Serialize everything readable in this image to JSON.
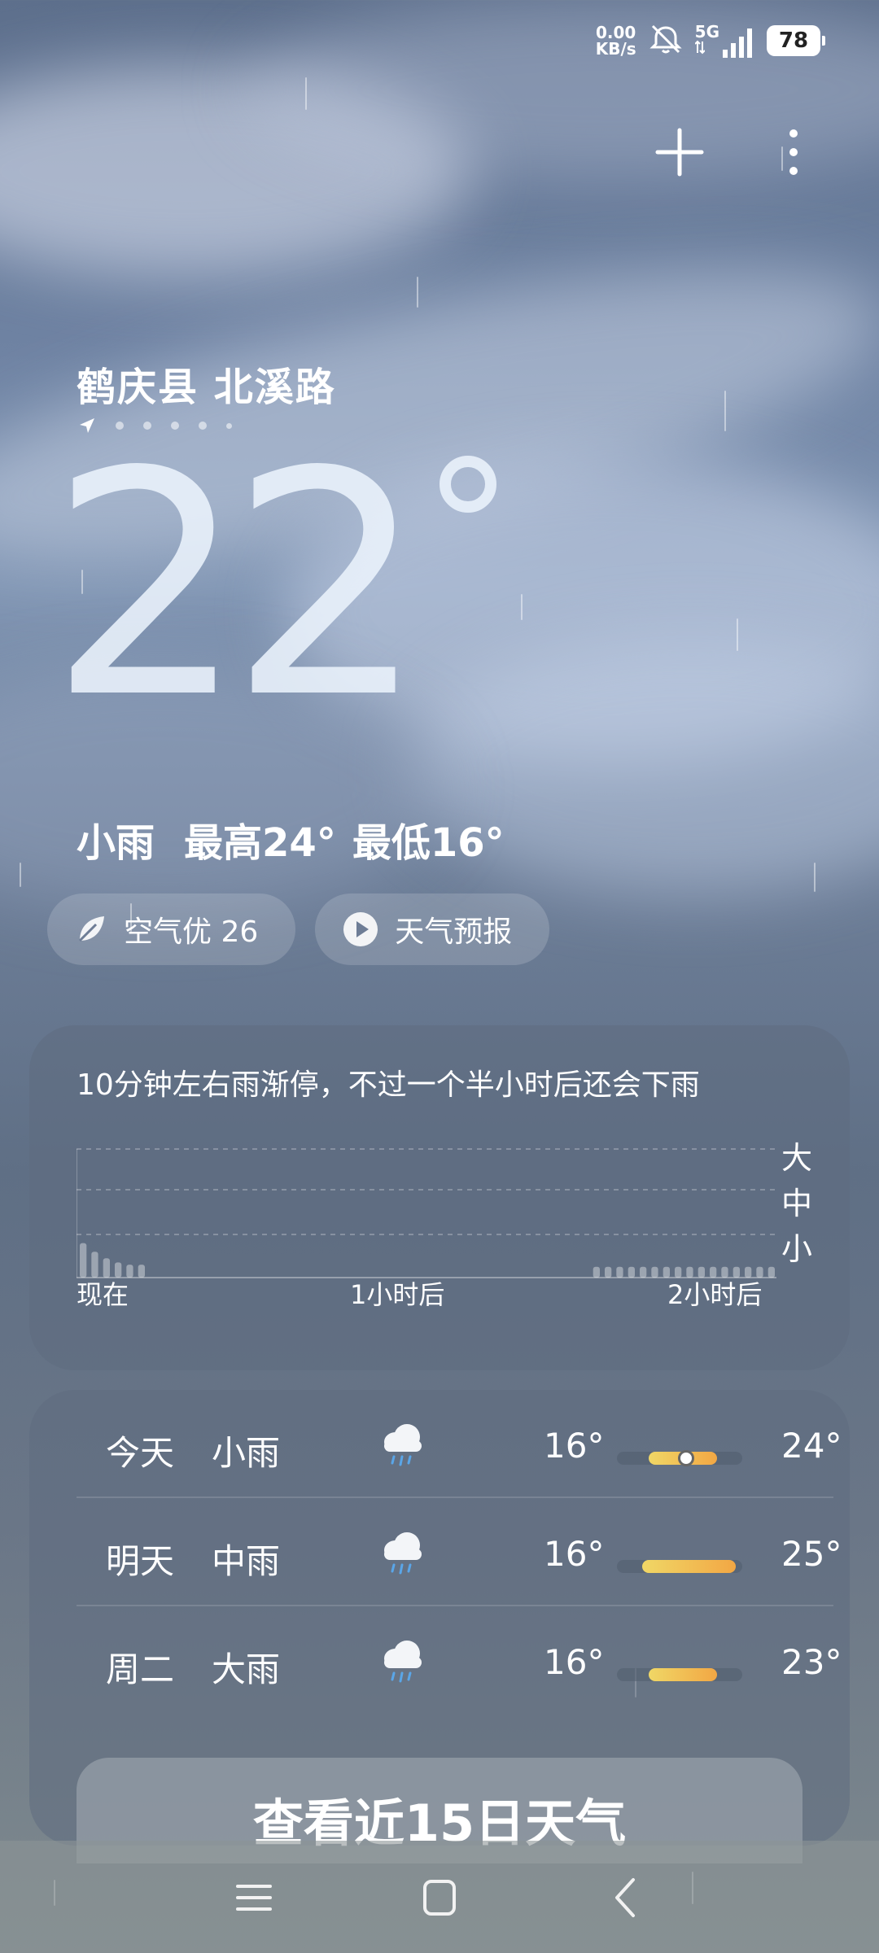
{
  "status_bar": {
    "net_speed_value": "0.00",
    "net_speed_unit": "KB/s",
    "network_type": "5G",
    "battery_level": "78",
    "icons": [
      "mute-vibrate-icon",
      "signal-icon",
      "battery-icon"
    ]
  },
  "header": {
    "location": "鹤庆县 北溪路",
    "page_count": 6,
    "current_page": 0
  },
  "current": {
    "temperature": "22",
    "condition": "小雨",
    "high": "最高24°",
    "low": "最低16°"
  },
  "pills": {
    "air_quality": "空气优 26",
    "forecast_video": "天气预报"
  },
  "rain_card": {
    "message": "10分钟左右雨渐停，不过一个半小时后还会下雨",
    "levels": [
      "大",
      "中",
      "小"
    ],
    "x_labels": [
      "现在",
      "1小时后",
      "2小时后"
    ]
  },
  "chart_data": {
    "type": "bar",
    "title": "",
    "xlabel": "",
    "ylabel": "",
    "categories": [
      "现在",
      "1小时后",
      "2小时后"
    ],
    "x_range_minutes": [
      0,
      120
    ],
    "ylim": [
      0,
      3
    ],
    "y_levels": [
      "小",
      "中",
      "大"
    ],
    "series": [
      {
        "values": [
          0.8,
          0.6,
          0.45,
          0.35,
          0.3,
          0.3,
          0,
          0,
          0,
          0,
          0,
          0,
          0,
          0,
          0,
          0,
          0,
          0,
          0,
          0,
          0,
          0,
          0,
          0,
          0,
          0,
          0,
          0,
          0,
          0,
          0,
          0,
          0,
          0,
          0,
          0,
          0,
          0,
          0,
          0,
          0,
          0,
          0,
          0,
          0.25,
          0.25,
          0.25,
          0.25,
          0.25,
          0.25,
          0.25,
          0.25,
          0.25,
          0.25,
          0.25,
          0.25,
          0.25,
          0.25,
          0.25,
          0.25
        ]
      }
    ]
  },
  "forecast": {
    "days": [
      {
        "name": "今天",
        "condition": "小雨",
        "icon": "light-rain-icon",
        "low": "16°",
        "high": "24°",
        "range_start": 0.25,
        "range_end": 0.8,
        "now_pos": 0.55
      },
      {
        "name": "明天",
        "condition": "中雨",
        "icon": "moderate-rain-icon",
        "low": "16°",
        "high": "25°",
        "range_start": 0.2,
        "range_end": 0.95
      },
      {
        "name": "周二",
        "condition": "大雨",
        "icon": "heavy-rain-icon",
        "low": "16°",
        "high": "23°",
        "range_start": 0.25,
        "range_end": 0.8
      }
    ],
    "more_button": "查看近15日天气"
  },
  "colors": {
    "temp_bar_start": "#f0d766",
    "temp_bar_end": "#f2a744"
  }
}
